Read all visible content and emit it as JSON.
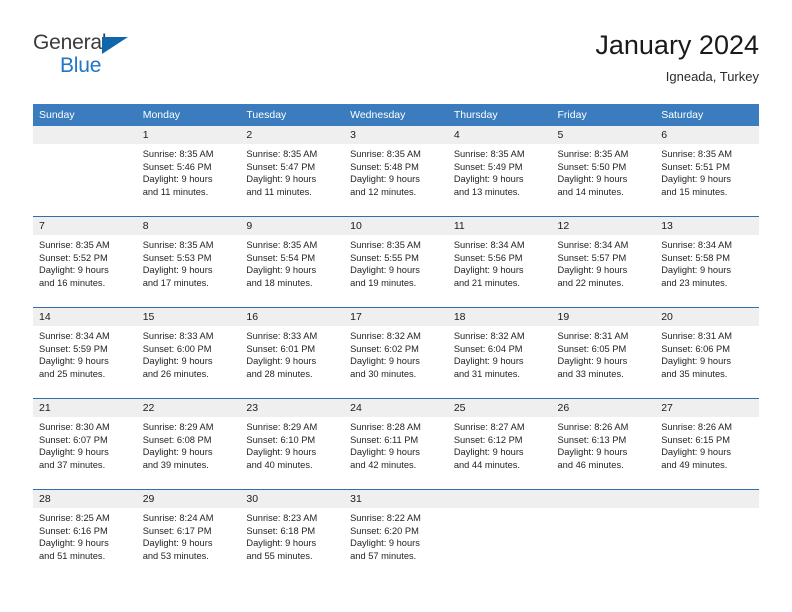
{
  "brand": {
    "name_top": "General",
    "name_bottom": "Blue",
    "triangle_color": "#1166aa",
    "blue_color": "#2176c7"
  },
  "header": {
    "title": "January 2024",
    "subtitle": "Igneada, Turkey"
  },
  "theme": {
    "header_blue": "#3a7cbe",
    "row_rule_blue": "#2f6fae",
    "daynum_band": "#efefef"
  },
  "weekday_headers": [
    "Sunday",
    "Monday",
    "Tuesday",
    "Wednesday",
    "Thursday",
    "Friday",
    "Saturday"
  ],
  "weeks": [
    [
      {
        "day": "",
        "lines": []
      },
      {
        "day": "1",
        "lines": [
          "Sunrise: 8:35 AM",
          "Sunset: 5:46 PM",
          "Daylight: 9 hours",
          "and 11 minutes."
        ]
      },
      {
        "day": "2",
        "lines": [
          "Sunrise: 8:35 AM",
          "Sunset: 5:47 PM",
          "Daylight: 9 hours",
          "and 11 minutes."
        ]
      },
      {
        "day": "3",
        "lines": [
          "Sunrise: 8:35 AM",
          "Sunset: 5:48 PM",
          "Daylight: 9 hours",
          "and 12 minutes."
        ]
      },
      {
        "day": "4",
        "lines": [
          "Sunrise: 8:35 AM",
          "Sunset: 5:49 PM",
          "Daylight: 9 hours",
          "and 13 minutes."
        ]
      },
      {
        "day": "5",
        "lines": [
          "Sunrise: 8:35 AM",
          "Sunset: 5:50 PM",
          "Daylight: 9 hours",
          "and 14 minutes."
        ]
      },
      {
        "day": "6",
        "lines": [
          "Sunrise: 8:35 AM",
          "Sunset: 5:51 PM",
          "Daylight: 9 hours",
          "and 15 minutes."
        ]
      }
    ],
    [
      {
        "day": "7",
        "lines": [
          "Sunrise: 8:35 AM",
          "Sunset: 5:52 PM",
          "Daylight: 9 hours",
          "and 16 minutes."
        ]
      },
      {
        "day": "8",
        "lines": [
          "Sunrise: 8:35 AM",
          "Sunset: 5:53 PM",
          "Daylight: 9 hours",
          "and 17 minutes."
        ]
      },
      {
        "day": "9",
        "lines": [
          "Sunrise: 8:35 AM",
          "Sunset: 5:54 PM",
          "Daylight: 9 hours",
          "and 18 minutes."
        ]
      },
      {
        "day": "10",
        "lines": [
          "Sunrise: 8:35 AM",
          "Sunset: 5:55 PM",
          "Daylight: 9 hours",
          "and 19 minutes."
        ]
      },
      {
        "day": "11",
        "lines": [
          "Sunrise: 8:34 AM",
          "Sunset: 5:56 PM",
          "Daylight: 9 hours",
          "and 21 minutes."
        ]
      },
      {
        "day": "12",
        "lines": [
          "Sunrise: 8:34 AM",
          "Sunset: 5:57 PM",
          "Daylight: 9 hours",
          "and 22 minutes."
        ]
      },
      {
        "day": "13",
        "lines": [
          "Sunrise: 8:34 AM",
          "Sunset: 5:58 PM",
          "Daylight: 9 hours",
          "and 23 minutes."
        ]
      }
    ],
    [
      {
        "day": "14",
        "lines": [
          "Sunrise: 8:34 AM",
          "Sunset: 5:59 PM",
          "Daylight: 9 hours",
          "and 25 minutes."
        ]
      },
      {
        "day": "15",
        "lines": [
          "Sunrise: 8:33 AM",
          "Sunset: 6:00 PM",
          "Daylight: 9 hours",
          "and 26 minutes."
        ]
      },
      {
        "day": "16",
        "lines": [
          "Sunrise: 8:33 AM",
          "Sunset: 6:01 PM",
          "Daylight: 9 hours",
          "and 28 minutes."
        ]
      },
      {
        "day": "17",
        "lines": [
          "Sunrise: 8:32 AM",
          "Sunset: 6:02 PM",
          "Daylight: 9 hours",
          "and 30 minutes."
        ]
      },
      {
        "day": "18",
        "lines": [
          "Sunrise: 8:32 AM",
          "Sunset: 6:04 PM",
          "Daylight: 9 hours",
          "and 31 minutes."
        ]
      },
      {
        "day": "19",
        "lines": [
          "Sunrise: 8:31 AM",
          "Sunset: 6:05 PM",
          "Daylight: 9 hours",
          "and 33 minutes."
        ]
      },
      {
        "day": "20",
        "lines": [
          "Sunrise: 8:31 AM",
          "Sunset: 6:06 PM",
          "Daylight: 9 hours",
          "and 35 minutes."
        ]
      }
    ],
    [
      {
        "day": "21",
        "lines": [
          "Sunrise: 8:30 AM",
          "Sunset: 6:07 PM",
          "Daylight: 9 hours",
          "and 37 minutes."
        ]
      },
      {
        "day": "22",
        "lines": [
          "Sunrise: 8:29 AM",
          "Sunset: 6:08 PM",
          "Daylight: 9 hours",
          "and 39 minutes."
        ]
      },
      {
        "day": "23",
        "lines": [
          "Sunrise: 8:29 AM",
          "Sunset: 6:10 PM",
          "Daylight: 9 hours",
          "and 40 minutes."
        ]
      },
      {
        "day": "24",
        "lines": [
          "Sunrise: 8:28 AM",
          "Sunset: 6:11 PM",
          "Daylight: 9 hours",
          "and 42 minutes."
        ]
      },
      {
        "day": "25",
        "lines": [
          "Sunrise: 8:27 AM",
          "Sunset: 6:12 PM",
          "Daylight: 9 hours",
          "and 44 minutes."
        ]
      },
      {
        "day": "26",
        "lines": [
          "Sunrise: 8:26 AM",
          "Sunset: 6:13 PM",
          "Daylight: 9 hours",
          "and 46 minutes."
        ]
      },
      {
        "day": "27",
        "lines": [
          "Sunrise: 8:26 AM",
          "Sunset: 6:15 PM",
          "Daylight: 9 hours",
          "and 49 minutes."
        ]
      }
    ],
    [
      {
        "day": "28",
        "lines": [
          "Sunrise: 8:25 AM",
          "Sunset: 6:16 PM",
          "Daylight: 9 hours",
          "and 51 minutes."
        ]
      },
      {
        "day": "29",
        "lines": [
          "Sunrise: 8:24 AM",
          "Sunset: 6:17 PM",
          "Daylight: 9 hours",
          "and 53 minutes."
        ]
      },
      {
        "day": "30",
        "lines": [
          "Sunrise: 8:23 AM",
          "Sunset: 6:18 PM",
          "Daylight: 9 hours",
          "and 55 minutes."
        ]
      },
      {
        "day": "31",
        "lines": [
          "Sunrise: 8:22 AM",
          "Sunset: 6:20 PM",
          "Daylight: 9 hours",
          "and 57 minutes."
        ]
      },
      {
        "day": "",
        "lines": []
      },
      {
        "day": "",
        "lines": []
      },
      {
        "day": "",
        "lines": []
      }
    ]
  ]
}
